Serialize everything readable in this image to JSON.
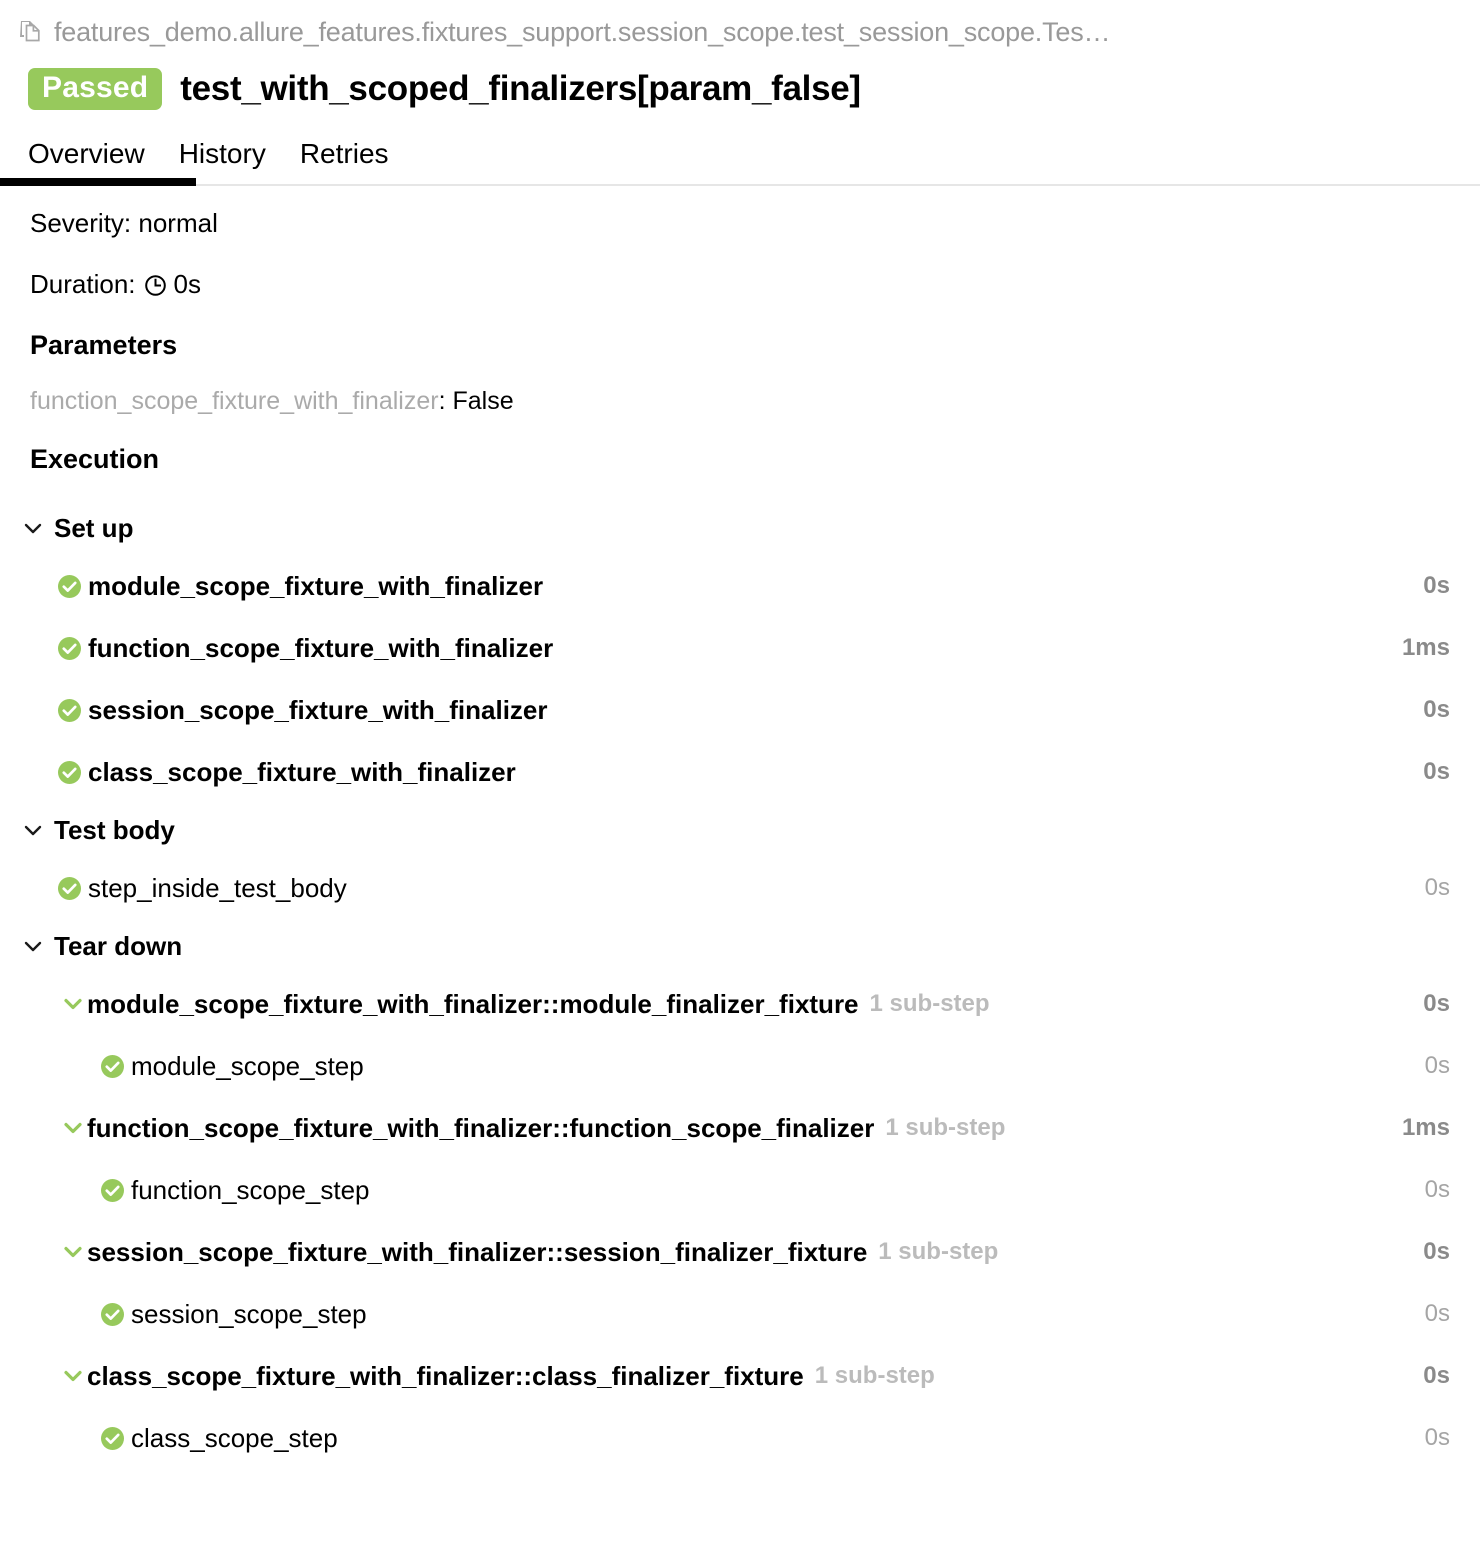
{
  "breadcrumb": {
    "icon": "documents-icon",
    "text": "features_demo.allure_features.fixtures_support.session_scope.test_session_scope.Tes…"
  },
  "header": {
    "status_label": "Passed",
    "status_color": "#97c95c",
    "title": "test_with_scoped_finalizers[param_false]"
  },
  "tabs": [
    {
      "label": "Overview",
      "active": true
    },
    {
      "label": "History",
      "active": false
    },
    {
      "label": "Retries",
      "active": false
    }
  ],
  "meta": {
    "severity": "Severity: normal",
    "duration_label": "Duration:",
    "duration_value": "0s",
    "duration_icon": "clock-icon"
  },
  "parameters": {
    "heading": "Parameters",
    "items": [
      {
        "name": "function_scope_fixture_with_finalizer",
        "separator": ": ",
        "value": "False"
      }
    ]
  },
  "execution": {
    "heading": "Execution",
    "groups": [
      {
        "title": "Set up",
        "chevron": "chevron-down-icon",
        "rows": [
          {
            "label": "module_scope_fixture_with_finalizer",
            "bold": true,
            "duration": "0s",
            "duration_bold": true,
            "icon": "check-circle-icon",
            "level": "step"
          },
          {
            "label": "function_scope_fixture_with_finalizer",
            "bold": true,
            "duration": "1ms",
            "duration_bold": true,
            "icon": "check-circle-icon",
            "level": "step"
          },
          {
            "label": "session_scope_fixture_with_finalizer",
            "bold": true,
            "duration": "0s",
            "duration_bold": true,
            "icon": "check-circle-icon",
            "level": "step"
          },
          {
            "label": "class_scope_fixture_with_finalizer",
            "bold": true,
            "duration": "0s",
            "duration_bold": true,
            "icon": "check-circle-icon",
            "level": "step"
          }
        ]
      },
      {
        "title": "Test body",
        "chevron": "chevron-down-icon",
        "rows": [
          {
            "label": "step_inside_test_body",
            "bold": false,
            "duration": "0s",
            "duration_bold": false,
            "icon": "check-circle-icon",
            "level": "step"
          }
        ]
      },
      {
        "title": "Tear down",
        "chevron": "chevron-down-icon",
        "rows": [
          {
            "label": "module_scope_fixture_with_finalizer::module_finalizer_fixture",
            "bold": true,
            "substeps": "1 sub-step",
            "duration": "0s",
            "duration_bold": true,
            "icon": "chevron-down-green-icon",
            "level": "parent"
          },
          {
            "label": "module_scope_step",
            "bold": false,
            "duration": "0s",
            "duration_bold": false,
            "icon": "check-circle-icon",
            "level": "sub"
          },
          {
            "label": "function_scope_fixture_with_finalizer::function_scope_finalizer",
            "bold": true,
            "substeps": "1 sub-step",
            "duration": "1ms",
            "duration_bold": true,
            "icon": "chevron-down-green-icon",
            "level": "parent"
          },
          {
            "label": "function_scope_step",
            "bold": false,
            "duration": "0s",
            "duration_bold": false,
            "icon": "check-circle-icon",
            "level": "sub"
          },
          {
            "label": "session_scope_fixture_with_finalizer::session_finalizer_fixture",
            "bold": true,
            "substeps": "1 sub-step",
            "duration": "0s",
            "duration_bold": true,
            "icon": "chevron-down-green-icon",
            "level": "parent"
          },
          {
            "label": "session_scope_step",
            "bold": false,
            "duration": "0s",
            "duration_bold": false,
            "icon": "check-circle-icon",
            "level": "sub"
          },
          {
            "label": "class_scope_fixture_with_finalizer::class_finalizer_fixture",
            "bold": true,
            "substeps": "1 sub-step",
            "duration": "0s",
            "duration_bold": true,
            "icon": "chevron-down-green-icon",
            "level": "parent"
          },
          {
            "label": "class_scope_step",
            "bold": false,
            "duration": "0s",
            "duration_bold": false,
            "icon": "check-circle-icon",
            "level": "sub"
          }
        ]
      }
    ]
  },
  "colors": {
    "pass_green": "#97c95c",
    "muted_grey": "#999999",
    "duration_grey": "#8a8a8a",
    "substep_grey": "#bbbbbb"
  }
}
